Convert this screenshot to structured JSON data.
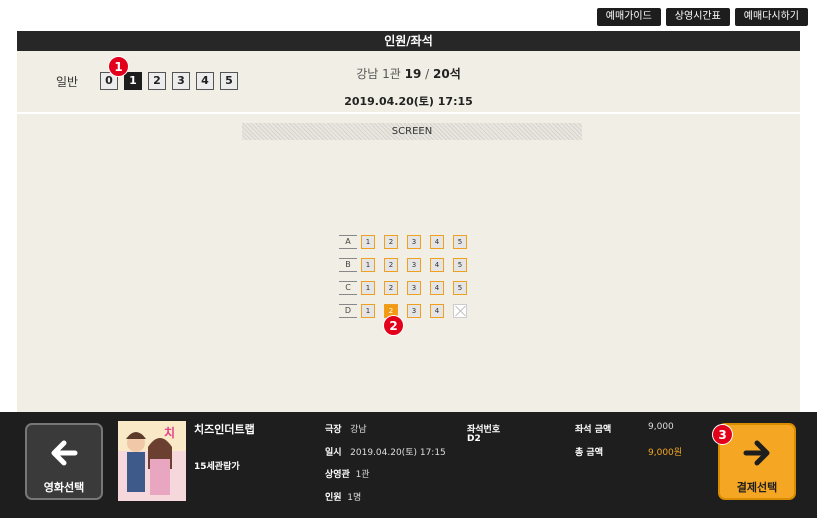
{
  "top_buttons": [
    "예매가이드",
    "상영시간표",
    "예매다시하기"
  ],
  "header": {
    "title": "인원/좌석"
  },
  "audience": {
    "label": "일반",
    "counts": [
      "0",
      "1",
      "2",
      "3",
      "4",
      "5"
    ],
    "selected_count": "1"
  },
  "theater": {
    "name": "강남 1관",
    "remaining": "19",
    "separator": "/",
    "total": "20석",
    "datetime": "2019.04.20(토)  17:15"
  },
  "screen_label": "SCREEN",
  "seat_map": {
    "rows": [
      {
        "label": "A",
        "seats": [
          {
            "n": "1",
            "state": "available"
          },
          {
            "n": "2",
            "state": "available"
          },
          {
            "n": "3",
            "state": "available"
          },
          {
            "n": "4",
            "state": "available"
          },
          {
            "n": "5",
            "state": "available"
          }
        ]
      },
      {
        "label": "B",
        "seats": [
          {
            "n": "1",
            "state": "available"
          },
          {
            "n": "2",
            "state": "available"
          },
          {
            "n": "3",
            "state": "available"
          },
          {
            "n": "4",
            "state": "available"
          },
          {
            "n": "5",
            "state": "available"
          }
        ]
      },
      {
        "label": "C",
        "seats": [
          {
            "n": "1",
            "state": "available"
          },
          {
            "n": "2",
            "state": "available"
          },
          {
            "n": "3",
            "state": "available"
          },
          {
            "n": "4",
            "state": "available"
          },
          {
            "n": "5",
            "state": "available"
          }
        ]
      },
      {
        "label": "D",
        "seats": [
          {
            "n": "1",
            "state": "available"
          },
          {
            "n": "2",
            "state": "selected"
          },
          {
            "n": "3",
            "state": "available"
          },
          {
            "n": "4",
            "state": "available"
          },
          {
            "n": "",
            "state": "unavailable"
          }
        ]
      }
    ]
  },
  "markers": [
    "1",
    "2",
    "3"
  ],
  "summary": {
    "prev_label": "영화선택",
    "next_label": "결제선택",
    "movie_title": "치즈인더트랩",
    "movie_rating": "15세관람가",
    "theater_key": "극장",
    "theater_val": "강남",
    "datetime_key": "일시",
    "datetime_val": "2019.04.20(토) 17:15",
    "hall_key": "상영관",
    "hall_val": "1관",
    "people_key": "인원",
    "people_val": "1명",
    "seat_num_key": "좌석번호",
    "seat_num_val": "D2",
    "seat_price_key": "좌석 금액",
    "seat_price_val": "9,000",
    "total_key": "총 금액",
    "total_val": "9,000원"
  },
  "colors": {
    "accent": "#f5a623",
    "marker": "#e2001a",
    "panel": "#f1efe5",
    "dark": "#1e1e1e"
  }
}
